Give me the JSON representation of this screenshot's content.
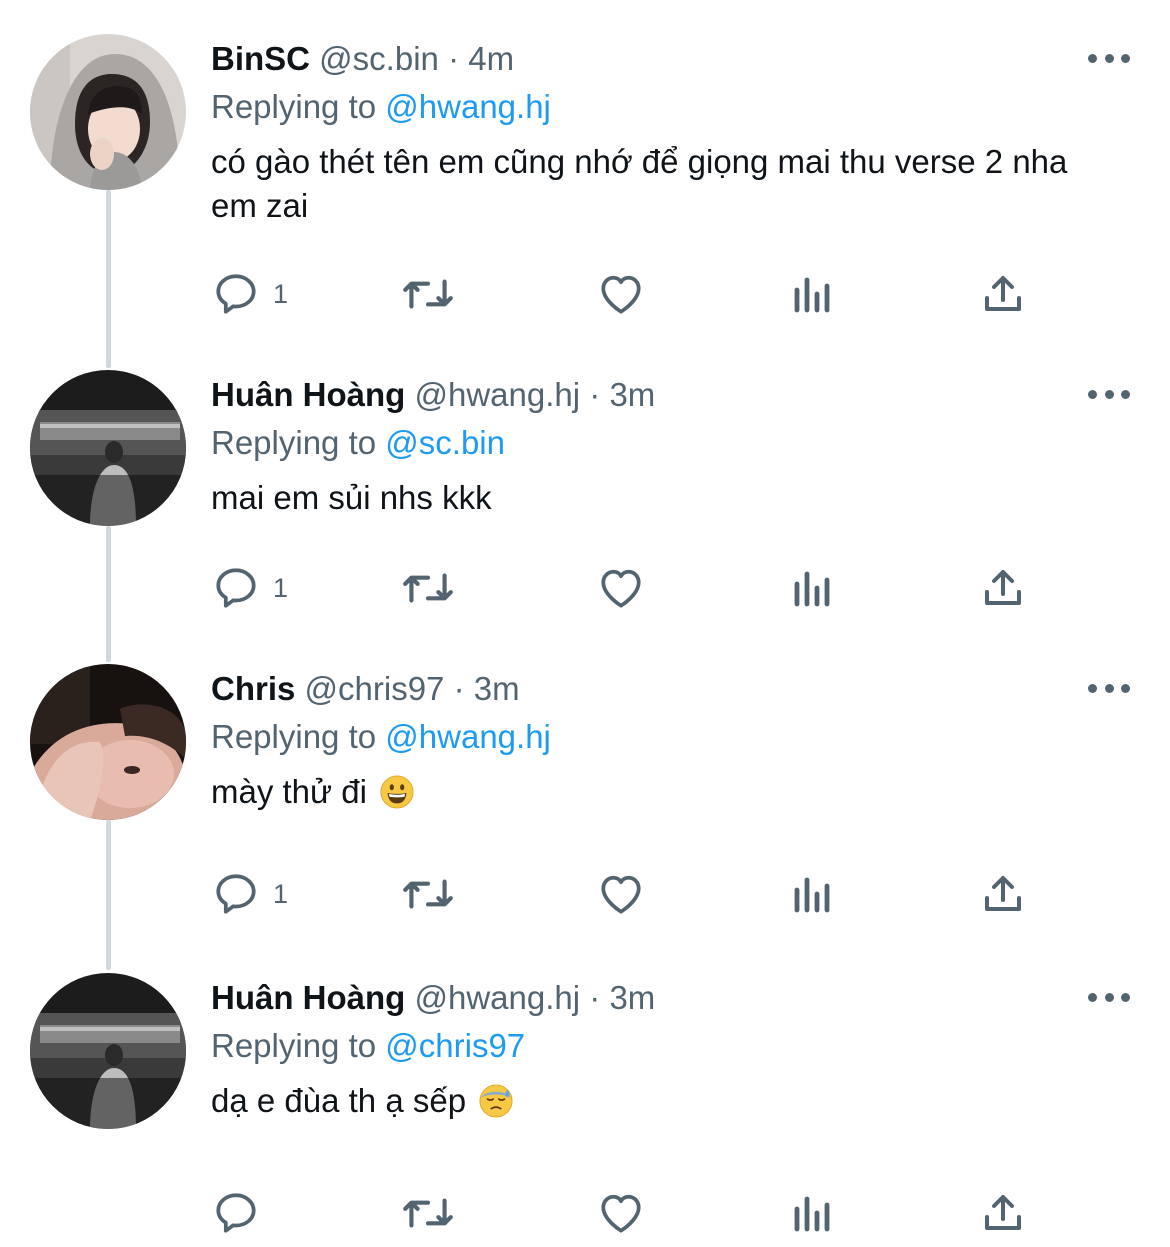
{
  "tweets": [
    {
      "display_name": "BinSC",
      "handle": "@sc.bin",
      "separator": "·",
      "time": "4m",
      "replying_label": "Replying to",
      "replying_to": "@hwang.hj",
      "text": "có gào thét tên em cũng nhớ để giọng mai thu verse 2 nha em zai",
      "reply_count": "1"
    },
    {
      "display_name": "Huân Hoàng",
      "handle": "@hwang.hj",
      "separator": "·",
      "time": "3m",
      "replying_label": "Replying to",
      "replying_to": "@sc.bin",
      "text": "mai em sủi nhs kkk",
      "reply_count": "1"
    },
    {
      "display_name": "Chris",
      "handle": "@chris97",
      "separator": "·",
      "time": "3m",
      "replying_label": "Replying to",
      "replying_to": "@hwang.hj",
      "text": "mày thử đi",
      "emoji": "grinning-face",
      "reply_count": "1"
    },
    {
      "display_name": "Huân Hoàng",
      "handle": "@hwang.hj",
      "separator": "·",
      "time": "3m",
      "replying_label": "Replying to",
      "replying_to": "@chris97",
      "text": "dạ e đùa th ạ sếp",
      "emoji": "downcast-face-with-sweat",
      "reply_count": ""
    }
  ],
  "colors": {
    "text": "#0f1419",
    "secondary": "#536471",
    "link": "#1d9bf0",
    "thread_line": "#cfd9de"
  },
  "icons": [
    "reply-icon",
    "retweet-icon",
    "like-icon",
    "views-icon",
    "share-icon",
    "more-icon"
  ]
}
